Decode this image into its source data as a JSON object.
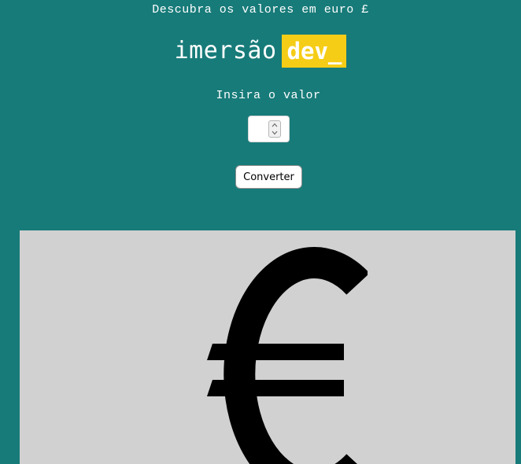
{
  "header": {
    "headline": "Descubra os valores em euro £",
    "logo_word": "imersão",
    "logo_badge": "dev_"
  },
  "form": {
    "prompt": "Insira o valor",
    "input_value": "",
    "input_placeholder": "",
    "convert_label": "Converter"
  },
  "image": {
    "icon": "euro-symbol"
  },
  "colors": {
    "background": "#177b79",
    "badge": "#f5cd17",
    "panel": "#d1d1d1"
  }
}
